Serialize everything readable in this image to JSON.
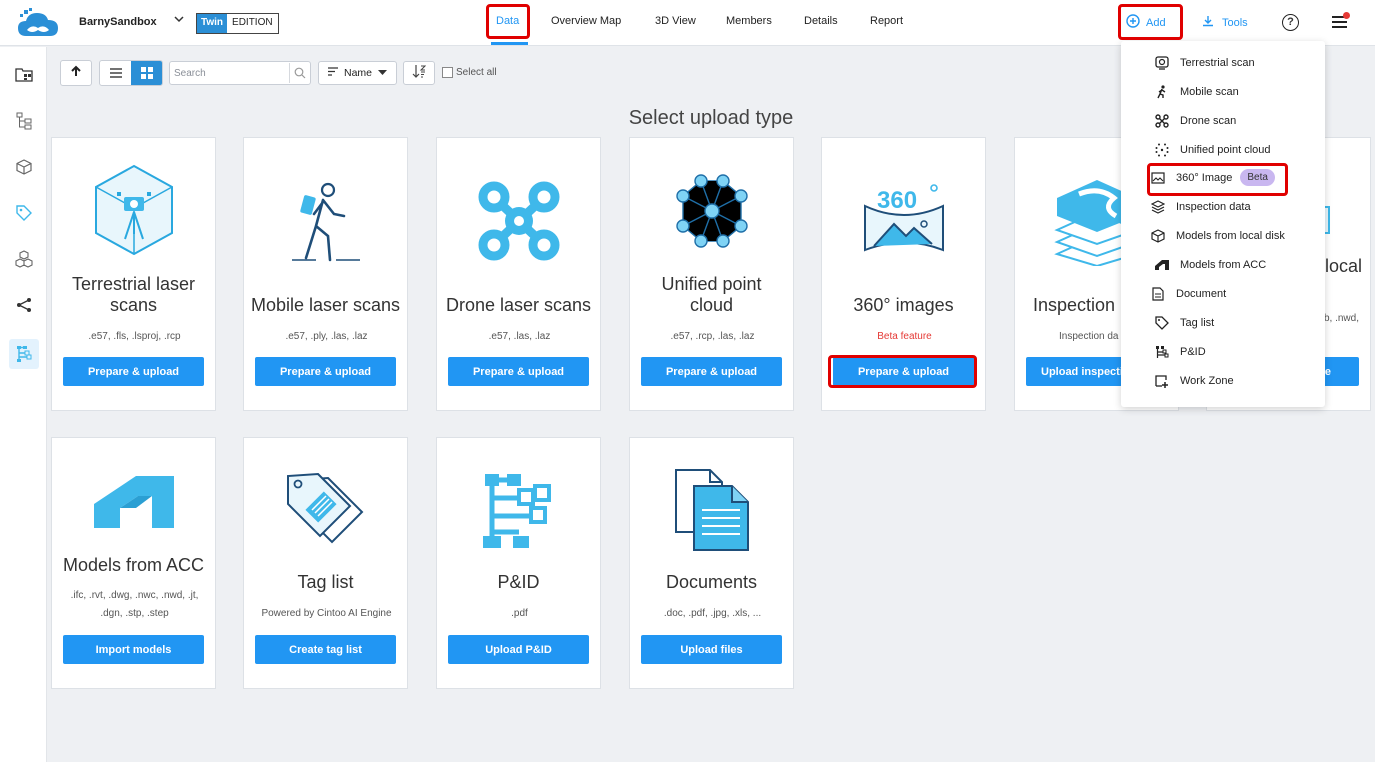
{
  "header": {
    "project_name": "BarnySandbox",
    "edition_badge": "Twin",
    "edition_label": "EDITION",
    "tabs": [
      {
        "label": "Data",
        "active": true
      },
      {
        "label": "Overview Map"
      },
      {
        "label": "3D View"
      },
      {
        "label": "Members"
      },
      {
        "label": "Details"
      },
      {
        "label": "Report"
      }
    ],
    "add_label": "Add",
    "tools_label": "Tools",
    "help_glyph": "?"
  },
  "sidebar": {
    "items": [
      "folder-grid-icon",
      "hierarchy-icon",
      "cube-icon",
      "tag-icon",
      "cubes-icon",
      "share-icon",
      "pid-icon"
    ],
    "active": "pid-icon"
  },
  "toolbar": {
    "search_placeholder": "Search",
    "sort_label": "Name",
    "select_all_label": "Select all"
  },
  "page_title": "Select upload type",
  "cards": [
    {
      "title": "Terrestrial laser scans",
      "title_line1": "Terrestrial laser",
      "title_line2": "scans",
      "desc": ".e57, .fls, .lsproj, .rcp",
      "button": "Prepare & upload",
      "icon": "terrestrial-scanner-icon"
    },
    {
      "title": "Mobile laser scans",
      "desc": ".e57, .ply, .las, .laz",
      "button": "Prepare & upload",
      "icon": "walking-scanner-icon"
    },
    {
      "title": "Drone laser scans",
      "desc": ".e57, .las, .laz",
      "button": "Prepare & upload",
      "icon": "drone-icon"
    },
    {
      "title_line1": "Unified point",
      "title_line2": "cloud",
      "desc": ".e57, .rcp, .las, .laz",
      "button": "Prepare & upload",
      "icon": "point-cloud-icon"
    },
    {
      "title": "360° images",
      "desc": "Beta feature",
      "button": "Prepare & upload",
      "icon": "panorama-360-icon"
    },
    {
      "title": "Inspection",
      "desc": "Inspection da",
      "button": "Upload inspectio",
      "icon": "layers-icon"
    },
    {
      "title": "local",
      "desc": "b, .nwd,",
      "button": "e",
      "icon": "model-icon"
    },
    {
      "title": "Models from ACC",
      "desc_line1": ".ifc, .rvt, .dwg, .nwc, .nwd, .jt,",
      "desc_line2": ".dgn, .stp, .step",
      "button": "Import models",
      "icon": "acc-logo-icon"
    },
    {
      "title": "Tag list",
      "desc": "Powered by Cintoo AI Engine",
      "button": "Create tag list",
      "icon": "tag-list-icon"
    },
    {
      "title": "P&ID",
      "desc": ".pdf",
      "button": "Upload P&ID",
      "icon": "pid-diagram-icon"
    },
    {
      "title": "Documents",
      "desc": ".doc, .pdf, .jpg, .xls, ...",
      "button": "Upload files",
      "icon": "documents-icon"
    }
  ],
  "add_menu": {
    "items": [
      {
        "label": "Terrestrial scan",
        "icon": "scanner-icon"
      },
      {
        "label": "Mobile scan",
        "icon": "walker-icon"
      },
      {
        "label": "Drone scan",
        "icon": "drone-icon"
      },
      {
        "label": "Unified point cloud",
        "icon": "point-cloud-icon"
      },
      {
        "label": "360° Image",
        "icon": "panorama-icon",
        "badge": "Beta"
      },
      {
        "label": "Inspection data",
        "icon": "layers-icon"
      },
      {
        "label": "Models from local disk",
        "icon": "cube-icon"
      },
      {
        "label": "Models from ACC",
        "icon": "acc-icon"
      },
      {
        "label": "Document",
        "icon": "document-icon"
      },
      {
        "label": "Tag list",
        "icon": "tag-icon"
      },
      {
        "label": "P&ID",
        "icon": "pid-icon"
      },
      {
        "label": "Work Zone",
        "icon": "work-zone-icon"
      }
    ]
  },
  "colors": {
    "accent": "#2196f3",
    "icon_blue": "#3fb8ea",
    "highlight": "#e00000",
    "beta_badge": "#c9b7f0",
    "beta_text": "#e53935"
  }
}
